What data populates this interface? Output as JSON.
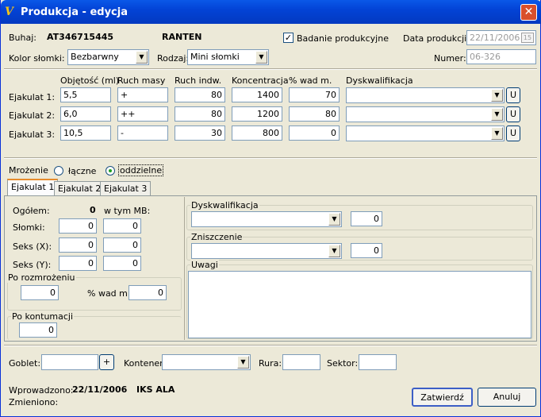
{
  "window": {
    "title": "Produkcja - edycja",
    "app_icon": "app-icon",
    "close_glyph": "✕"
  },
  "header": {
    "buhaj_label": "Buhaj:",
    "buhaj_id": "AT346715445",
    "buhaj_name": "RANTEN",
    "badanie_label": "Badanie produkcyjne",
    "badanie_checked": true,
    "check_glyph": "✓",
    "data_label": "Data produkcji:",
    "data_value": "22/11/2006",
    "kolor_label": "Kolor słomki:",
    "kolor_value": "Bezbarwny",
    "rodzaj_label": "Rodzaj:",
    "rodzaj_value": "Mini słomki",
    "numer_label": "Numer:",
    "numer_value": "06-326"
  },
  "ejakulaty": {
    "columns": [
      "Objętość (ml)",
      "Ruch masy",
      "Ruch indw.",
      "Koncentracja",
      "% wad m.",
      "Dyskwalifikacja"
    ],
    "rows": [
      {
        "label": "Ejakulat 1:",
        "objetosc": "5,5",
        "ruch_masy": "+",
        "ruch_indw": "80",
        "koncentracja": "1400",
        "wad": "70",
        "dysk": "",
        "u": "U"
      },
      {
        "label": "Ejakulat 2:",
        "objetosc": "6,0",
        "ruch_masy": "++",
        "ruch_indw": "80",
        "koncentracja": "1200",
        "wad": "80",
        "dysk": "",
        "u": "U"
      },
      {
        "label": "Ejakulat 3:",
        "objetosc": "10,5",
        "ruch_masy": "-",
        "ruch_indw": "30",
        "koncentracja": "800",
        "wad": "0",
        "dysk": "",
        "u": "U"
      }
    ]
  },
  "mrozenie": {
    "label": "Mrożenie",
    "opt1": "łączne",
    "opt2": "oddzielne",
    "selected": "oddzielne"
  },
  "tabs": [
    "Ejakulat 1",
    "Ejakulat 2",
    "Ejakulat 3"
  ],
  "tab1": {
    "ogolem_label": "Ogółem:",
    "ogolem_value": "0",
    "wtym_label": "w tym MB:",
    "slomki_label": "Słomki:",
    "slomki_a": "0",
    "slomki_b": "0",
    "seksx_label": "Seks (X):",
    "seksx_a": "0",
    "seksx_b": "0",
    "seksy_label": "Seks (Y):",
    "seksy_a": "0",
    "seksy_b": "0",
    "po_rozmrozeniu_label": "Po rozmrożeniu",
    "po_rozmrozeniu_value": "0",
    "wad_label": "% wad m.",
    "wad_value": "0",
    "po_kontumacji_label": "Po kontumacji",
    "po_kontumacji_value": "0",
    "dysk_label": "Dyskwalifikacja",
    "dysk_value": "0",
    "znisz_label": "Zniszczenie",
    "znisz_value": "0",
    "uwagi_label": "Uwagi",
    "uwagi_value": ""
  },
  "storage": {
    "goblet_label": "Goblet:",
    "plus": "+",
    "kontener_label": "Kontener:",
    "rura_label": "Rura:",
    "sektor_label": "Sektor:"
  },
  "footer": {
    "wprowadzono_label": "Wprowadzono:",
    "wprowadzono_date": "22/11/2006",
    "wprowadzono_user": "IKS ALA",
    "zmieniono_label": "Zmieniono:",
    "zatwierdz": "Zatwierdź",
    "anuluj": "Anuluj"
  },
  "arrow_glyph": "▼",
  "calendar_glyph": "15"
}
